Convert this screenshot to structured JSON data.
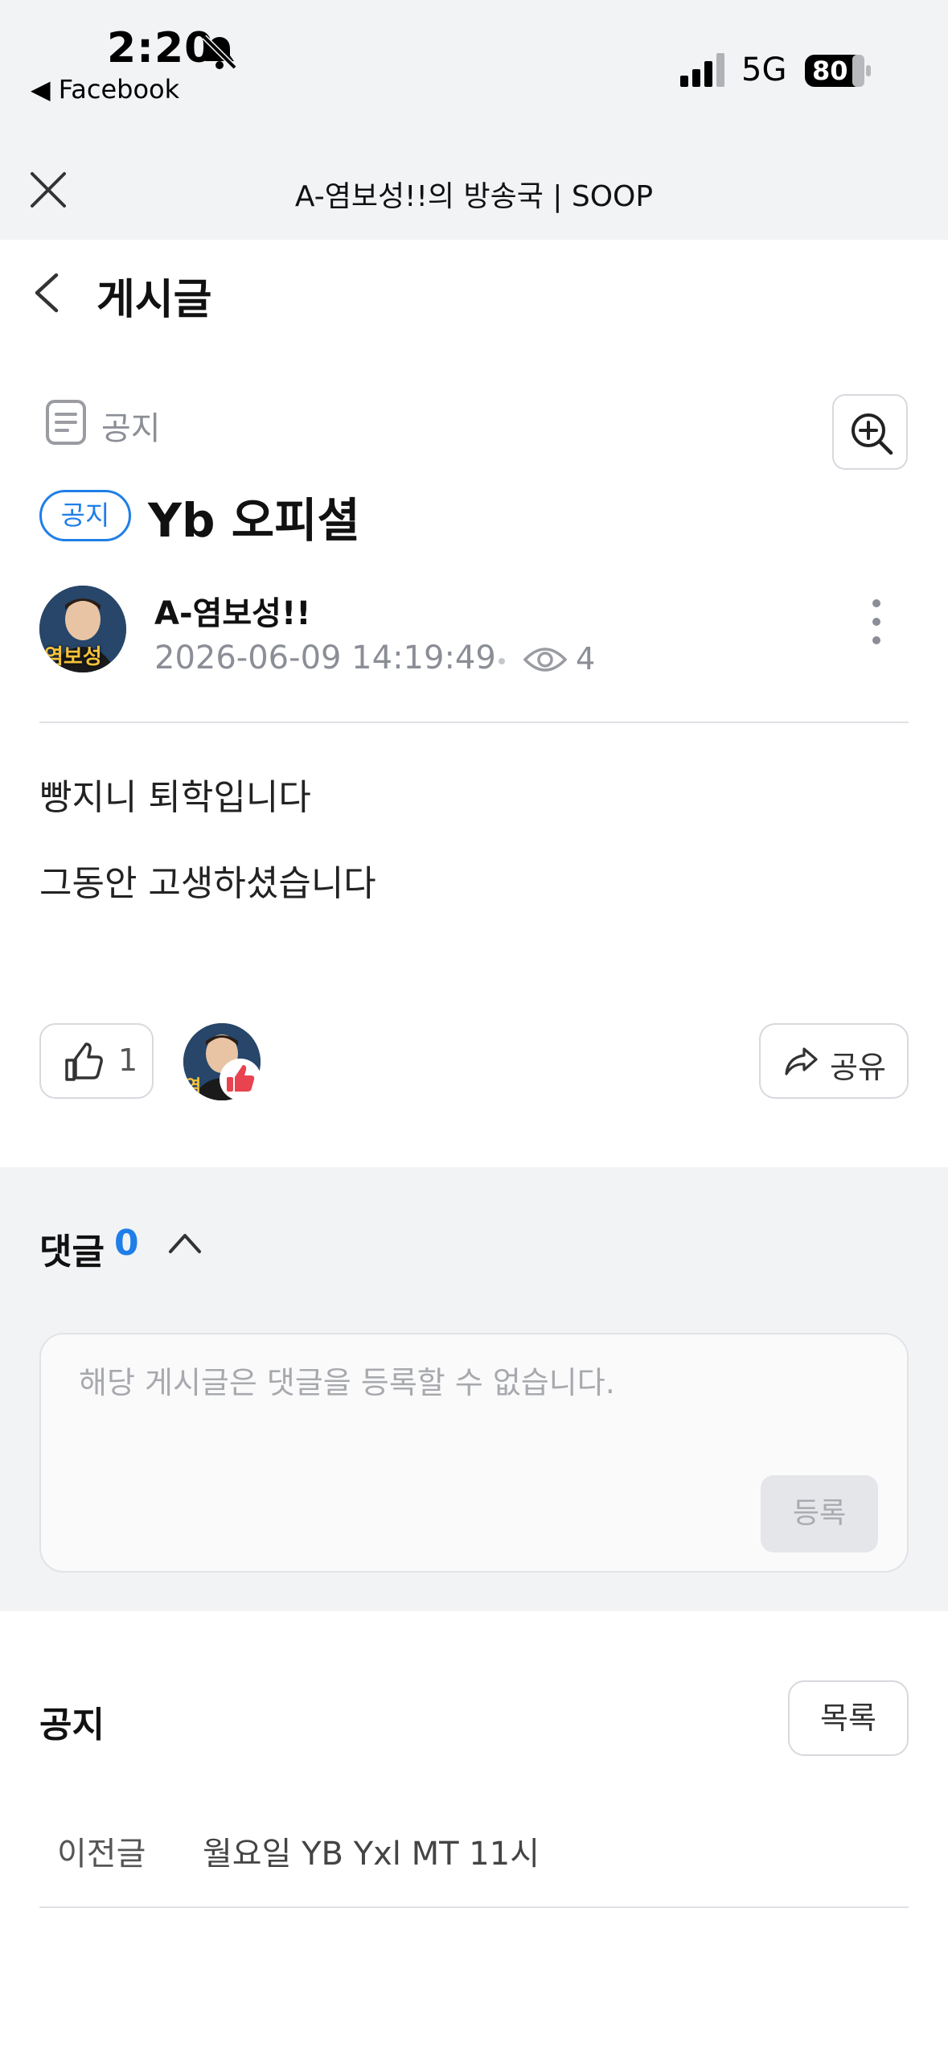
{
  "status_bar": {
    "time": "2:20",
    "back_app": "Facebook",
    "network": "5G",
    "battery": "80"
  },
  "browser": {
    "title": "A-염보성!!의 방송국 | SOOP"
  },
  "page": {
    "title": "게시글"
  },
  "post": {
    "category": "공지",
    "badge": "공지",
    "title": "Yb 오피셜",
    "author": "A-염보성!!",
    "date": "2026-06-09 14:19:49",
    "views": "4",
    "avatar_text": "염보성",
    "body": [
      "빵지니 퇴학입니다",
      "그동안 고생하셨습니다"
    ],
    "likes": "1",
    "share_label": "공유"
  },
  "comments": {
    "title": "댓글",
    "count": "0",
    "placeholder": "해당 게시글은 댓글을 등록할 수 없습니다.",
    "submit_label": "등록"
  },
  "board": {
    "title": "공지",
    "list_label": "목록",
    "prev_label": "이전글",
    "prev_title": "월요일 YB Yxl MT 11시"
  },
  "colors": {
    "accent": "#1f7ee8",
    "like_red": "#e8434f",
    "section_bg": "#f2f3f5"
  }
}
